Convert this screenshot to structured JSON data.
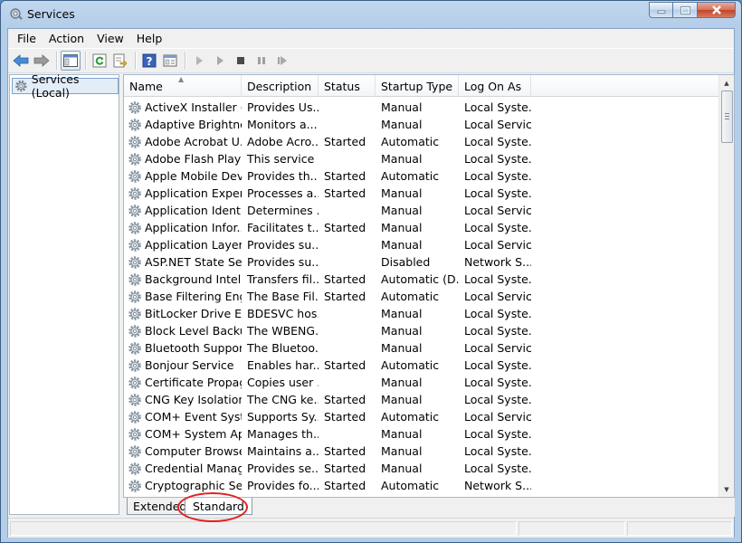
{
  "window": {
    "title": "Services"
  },
  "menu": [
    "File",
    "Action",
    "View",
    "Help"
  ],
  "toolbar": {
    "icons": [
      "back-arrow-icon",
      "forward-arrow-icon",
      "show-hide-console-tree-icon",
      "refresh-icon",
      "export-list-icon",
      "help-icon",
      "properties-icon",
      "start-service-icon",
      "start-service-alt-icon",
      "stop-service-icon",
      "pause-service-icon",
      "restart-service-icon"
    ]
  },
  "tree": {
    "root_label": "Services (Local)"
  },
  "columns": [
    "Name",
    "Description",
    "Status",
    "Startup Type",
    "Log On As"
  ],
  "services": [
    {
      "name": "ActiveX Installer (...",
      "desc": "Provides Us...",
      "status": "",
      "startup": "Manual",
      "logon": "Local Syste..."
    },
    {
      "name": "Adaptive Brightness",
      "desc": "Monitors a...",
      "status": "",
      "startup": "Manual",
      "logon": "Local Service"
    },
    {
      "name": "Adobe Acrobat U...",
      "desc": "Adobe Acro...",
      "status": "Started",
      "startup": "Automatic",
      "logon": "Local Syste..."
    },
    {
      "name": "Adobe Flash Playe...",
      "desc": "This service ...",
      "status": "",
      "startup": "Manual",
      "logon": "Local Syste..."
    },
    {
      "name": "Apple Mobile Devi...",
      "desc": "Provides th...",
      "status": "Started",
      "startup": "Automatic",
      "logon": "Local Syste..."
    },
    {
      "name": "Application Experi...",
      "desc": "Processes a...",
      "status": "Started",
      "startup": "Manual",
      "logon": "Local Syste..."
    },
    {
      "name": "Application Identity",
      "desc": "Determines ...",
      "status": "",
      "startup": "Manual",
      "logon": "Local Service"
    },
    {
      "name": "Application Infor...",
      "desc": "Facilitates t...",
      "status": "Started",
      "startup": "Manual",
      "logon": "Local Syste..."
    },
    {
      "name": "Application Layer ...",
      "desc": "Provides su...",
      "status": "",
      "startup": "Manual",
      "logon": "Local Service"
    },
    {
      "name": "ASP.NET State Ser...",
      "desc": "Provides su...",
      "status": "",
      "startup": "Disabled",
      "logon": "Network S..."
    },
    {
      "name": "Background Intelli...",
      "desc": "Transfers fil...",
      "status": "Started",
      "startup": "Automatic (D...",
      "logon": "Local Syste..."
    },
    {
      "name": "Base Filtering Engi...",
      "desc": "The Base Fil...",
      "status": "Started",
      "startup": "Automatic",
      "logon": "Local Service"
    },
    {
      "name": "BitLocker Drive En...",
      "desc": "BDESVC hos...",
      "status": "",
      "startup": "Manual",
      "logon": "Local Syste..."
    },
    {
      "name": "Block Level Backu...",
      "desc": "The WBENG...",
      "status": "",
      "startup": "Manual",
      "logon": "Local Syste..."
    },
    {
      "name": "Bluetooth Support...",
      "desc": "The Bluetoo...",
      "status": "",
      "startup": "Manual",
      "logon": "Local Service"
    },
    {
      "name": "Bonjour Service",
      "desc": "Enables har...",
      "status": "Started",
      "startup": "Automatic",
      "logon": "Local Syste..."
    },
    {
      "name": "Certificate Propag...",
      "desc": "Copies user ...",
      "status": "",
      "startup": "Manual",
      "logon": "Local Syste..."
    },
    {
      "name": "CNG Key Isolation",
      "desc": "The CNG ke...",
      "status": "Started",
      "startup": "Manual",
      "logon": "Local Syste..."
    },
    {
      "name": "COM+ Event Syst...",
      "desc": "Supports Sy...",
      "status": "Started",
      "startup": "Automatic",
      "logon": "Local Service"
    },
    {
      "name": "COM+ System Ap...",
      "desc": "Manages th...",
      "status": "",
      "startup": "Manual",
      "logon": "Local Syste..."
    },
    {
      "name": "Computer Browser",
      "desc": "Maintains a...",
      "status": "Started",
      "startup": "Manual",
      "logon": "Local Syste..."
    },
    {
      "name": "Credential Manager",
      "desc": "Provides se...",
      "status": "Started",
      "startup": "Manual",
      "logon": "Local Syste..."
    },
    {
      "name": "Cryptographic Ser...",
      "desc": "Provides fo...",
      "status": "Started",
      "startup": "Automatic",
      "logon": "Network S..."
    }
  ],
  "tabs": [
    "Extended",
    "Standard"
  ],
  "active_tab": "Standard",
  "annotation_color": "#e02020"
}
